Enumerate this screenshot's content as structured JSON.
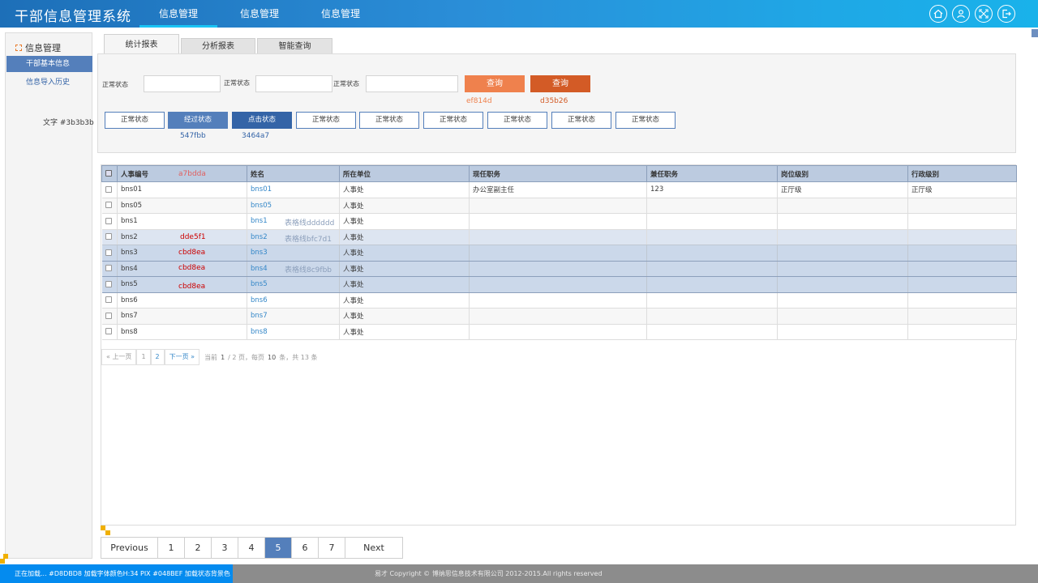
{
  "app": {
    "title": "干部信息管理系统",
    "nav": [
      "信息管理",
      "信息管理",
      "信息管理"
    ],
    "header_icons": [
      "home-icon",
      "user-icon",
      "fullscreen-icon",
      "logout-icon"
    ]
  },
  "sidebar": {
    "section_title": "信息管理",
    "items": [
      "干部基本信息",
      "信息导入历史"
    ],
    "note": "文字 #3b3b3b"
  },
  "tabs": [
    "统计报表",
    "分析报表",
    "智能查询"
  ],
  "filters": {
    "labels": [
      "正常状态",
      "正常状态",
      "正常状态"
    ],
    "query_buttons": [
      "查询",
      "查询"
    ],
    "query_notes": [
      "ef814d",
      "d35b26"
    ],
    "query_colors": [
      "#ef814d",
      "#d35b26"
    ]
  },
  "status_buttons": {
    "labels": [
      "正常状态",
      "经过状态",
      "点击状态",
      "正常状态",
      "正常状态",
      "正常状态",
      "正常状态",
      "正常状态",
      "正常状态"
    ],
    "notes": [
      "547fbb",
      "3464a7"
    ]
  },
  "table": {
    "headers": [
      "人事编号",
      "姓名",
      "所在单位",
      "现任职务",
      "兼任职务",
      "岗位级别",
      "行政级别"
    ],
    "header_note": "a7bdda",
    "rows": [
      [
        "bns01",
        "bns01",
        "人事处",
        "办公室副主任",
        "123",
        "正厅级",
        "正厅级"
      ],
      [
        "bns05",
        "bns05",
        "人事处",
        "",
        "",
        "",
        ""
      ],
      [
        "bns1",
        "bns1",
        "人事处",
        "",
        "",
        "",
        ""
      ],
      [
        "bns2",
        "bns2",
        "人事处",
        "",
        "",
        "",
        ""
      ],
      [
        "bns3",
        "bns3",
        "人事处",
        "",
        "",
        "",
        ""
      ],
      [
        "bns4",
        "bns4",
        "人事处",
        "",
        "",
        "",
        ""
      ],
      [
        "bns5",
        "bns5",
        "人事处",
        "",
        "",
        "",
        ""
      ],
      [
        "bns6",
        "bns6",
        "人事处",
        "",
        "",
        "",
        ""
      ],
      [
        "bns7",
        "bns7",
        "人事处",
        "",
        "",
        "",
        ""
      ],
      [
        "bns8",
        "bns8",
        "人事处",
        "",
        "",
        "",
        ""
      ]
    ],
    "row_notes": [
      "dde5f1",
      "cbd8ea",
      "cbd8ea",
      "cbd8ea"
    ],
    "line_notes": [
      "表格线dddddd",
      "表格线bfc7d1",
      "表格线8c9fbb"
    ]
  },
  "small_pager": {
    "prev": "« 上一页",
    "pages": [
      "1",
      "2"
    ],
    "next": "下一页 »",
    "current_label": "当前",
    "current": "1",
    "total_pages": "/ 2 页，每页",
    "per_page": "10",
    "total_label": "条，共 13 条"
  },
  "big_pager": {
    "prev": "Previous",
    "pages": [
      "1",
      "2",
      "3",
      "4",
      "5",
      "6",
      "7"
    ],
    "active": "5",
    "next": "Next"
  },
  "footer": {
    "loading": "正在加载... #D8DBD8 加载字体颜色H:34 PIX #048BEF 加载状态背景色",
    "copyright": "易才 Copyright © 博纳思信息技术有限公司 2012-2015.All rights reserved"
  }
}
